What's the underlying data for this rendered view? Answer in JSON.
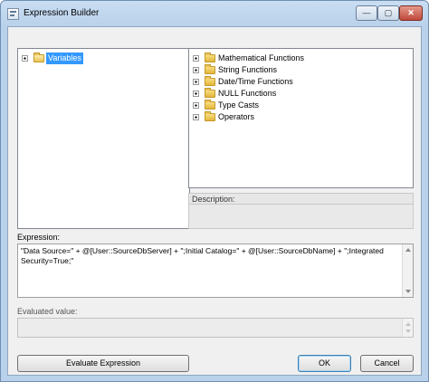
{
  "window": {
    "title": "Expression Builder",
    "controls": {
      "minimize": "—",
      "maximize": "▢",
      "close": "✕"
    }
  },
  "left_tree": {
    "items": [
      {
        "label": "Variables",
        "icon": "folder-open-icon",
        "selected": true
      }
    ]
  },
  "right_tree": {
    "items": [
      {
        "label": "Mathematical Functions",
        "icon": "folder-icon"
      },
      {
        "label": "String Functions",
        "icon": "folder-icon"
      },
      {
        "label": "Date/Time Functions",
        "icon": "folder-icon"
      },
      {
        "label": "NULL Functions",
        "icon": "folder-icon"
      },
      {
        "label": "Type Casts",
        "icon": "folder-icon"
      },
      {
        "label": "Operators",
        "icon": "folder-icon"
      }
    ]
  },
  "description": {
    "label": "Description:",
    "value": ""
  },
  "expression": {
    "label": "Expression:",
    "value": "\"Data Source=\" + @[User::SourceDbServer] +  \";Initial Catalog=\" + @[User::SourceDbName]  + \";Integrated Security=True;\""
  },
  "evaluated": {
    "label": "Evaluated value:",
    "value": ""
  },
  "buttons": {
    "evaluate": "Evaluate Expression",
    "ok": "OK",
    "cancel": "Cancel"
  },
  "colors": {
    "selection": "#3399ff",
    "folder": "#e9c458",
    "dialog_bg": "#f0f0f0"
  }
}
